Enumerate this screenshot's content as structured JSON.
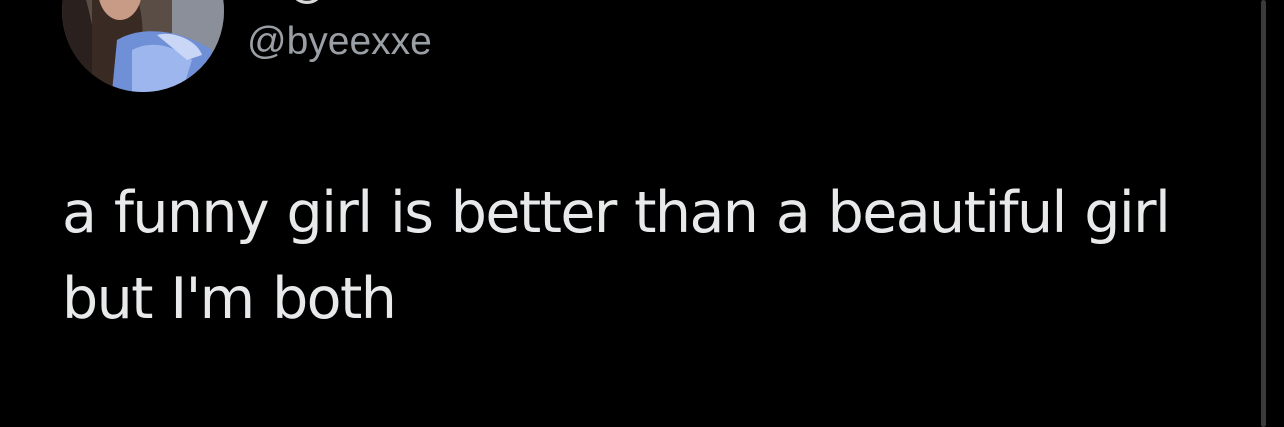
{
  "tweet": {
    "handle": "@byeexxe",
    "text_line_1": "a funny girl is better than a beautiful girl",
    "text_line_2": "but I'm both"
  },
  "colors": {
    "background": "#000000",
    "text": "#e7e9ea",
    "secondary": "#9a9fa5",
    "link": "#1d9bf0"
  },
  "icons": {
    "avatar": "profile-photo",
    "emoji": "face-emoji"
  }
}
